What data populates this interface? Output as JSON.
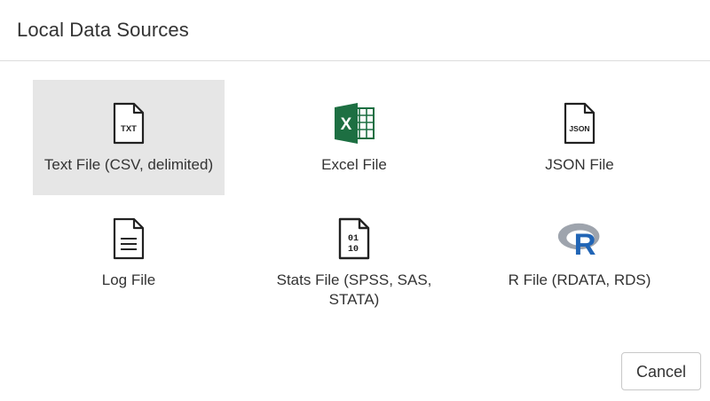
{
  "dialog": {
    "title": "Local Data Sources"
  },
  "sources": [
    {
      "label": "Text File (CSV, delimited)",
      "icon": "txt-file-icon",
      "icon_text": "TXT",
      "selected": true
    },
    {
      "label": "Excel File",
      "icon": "excel-icon",
      "icon_text": "X"
    },
    {
      "label": "JSON File",
      "icon": "json-file-icon",
      "icon_text": "JSON"
    },
    {
      "label": "Log File",
      "icon": "log-file-icon"
    },
    {
      "label": "Stats File (SPSS, SAS, STATA)",
      "icon": "binary-file-icon",
      "icon_text_top": "01",
      "icon_text_bottom": "10"
    },
    {
      "label": "R File (RDATA, RDS)",
      "icon": "r-logo-icon",
      "icon_text": "R"
    }
  ],
  "footer": {
    "cancel_label": "Cancel"
  },
  "colors": {
    "selected_bg": "#e6e6e6",
    "excel_green": "#1d6f42",
    "r_blue": "#2165b6",
    "r_ring": "#9ea4ad"
  }
}
